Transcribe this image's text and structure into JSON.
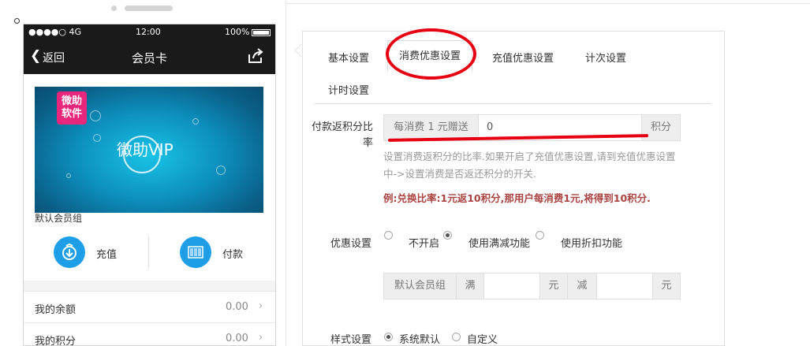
{
  "phone": {
    "status": {
      "signal": "●●●●○ 4G",
      "time": "12:00",
      "battery": "100%"
    },
    "nav": {
      "back": "返回",
      "title": "会员卡"
    },
    "card": {
      "badge_line1": "微助",
      "badge_line2": "软件",
      "title": "微助VIP",
      "group": "默认会员组"
    },
    "actions": {
      "recharge": "充值",
      "pay": "付款"
    },
    "list": [
      {
        "label": "我的余额",
        "value": "0.00"
      },
      {
        "label": "我的积分",
        "value": "0.00"
      }
    ]
  },
  "tabs": [
    "基本设置",
    "消费优惠设置",
    "充值优惠设置",
    "计次设置",
    "计时设置"
  ],
  "active_tab": "消费优惠设置",
  "form": {
    "points_label": "付款返积分比率",
    "points_prefix": "每消费 1 元赠送",
    "points_value": "0",
    "points_suffix": "积分",
    "help_text": "设置消费返积分的比率.如果开启了充值优惠设置,请到充值优惠设置中->设置消费是否返还积分的开关.",
    "example_text": "例:兑换比率:1元返10积分,那用户每消费1元,将得到10积分.",
    "discount_label": "优惠设置",
    "discount_options": [
      "不开启",
      "使用满减功能",
      "使用折扣功能"
    ],
    "discount_selected": "使用满减功能",
    "rule": {
      "group": "默认会员组",
      "full": "满",
      "yuan1": "元",
      "minus": "减",
      "yuan2": "元"
    },
    "style_label": "样式设置",
    "style_options": [
      "系统默认",
      "自定义"
    ],
    "style_selected": "系统默认"
  },
  "colors": {
    "highlight_red": "#e60012",
    "action_blue": "#1e9ee6",
    "badge_pink": "#e8277c"
  }
}
